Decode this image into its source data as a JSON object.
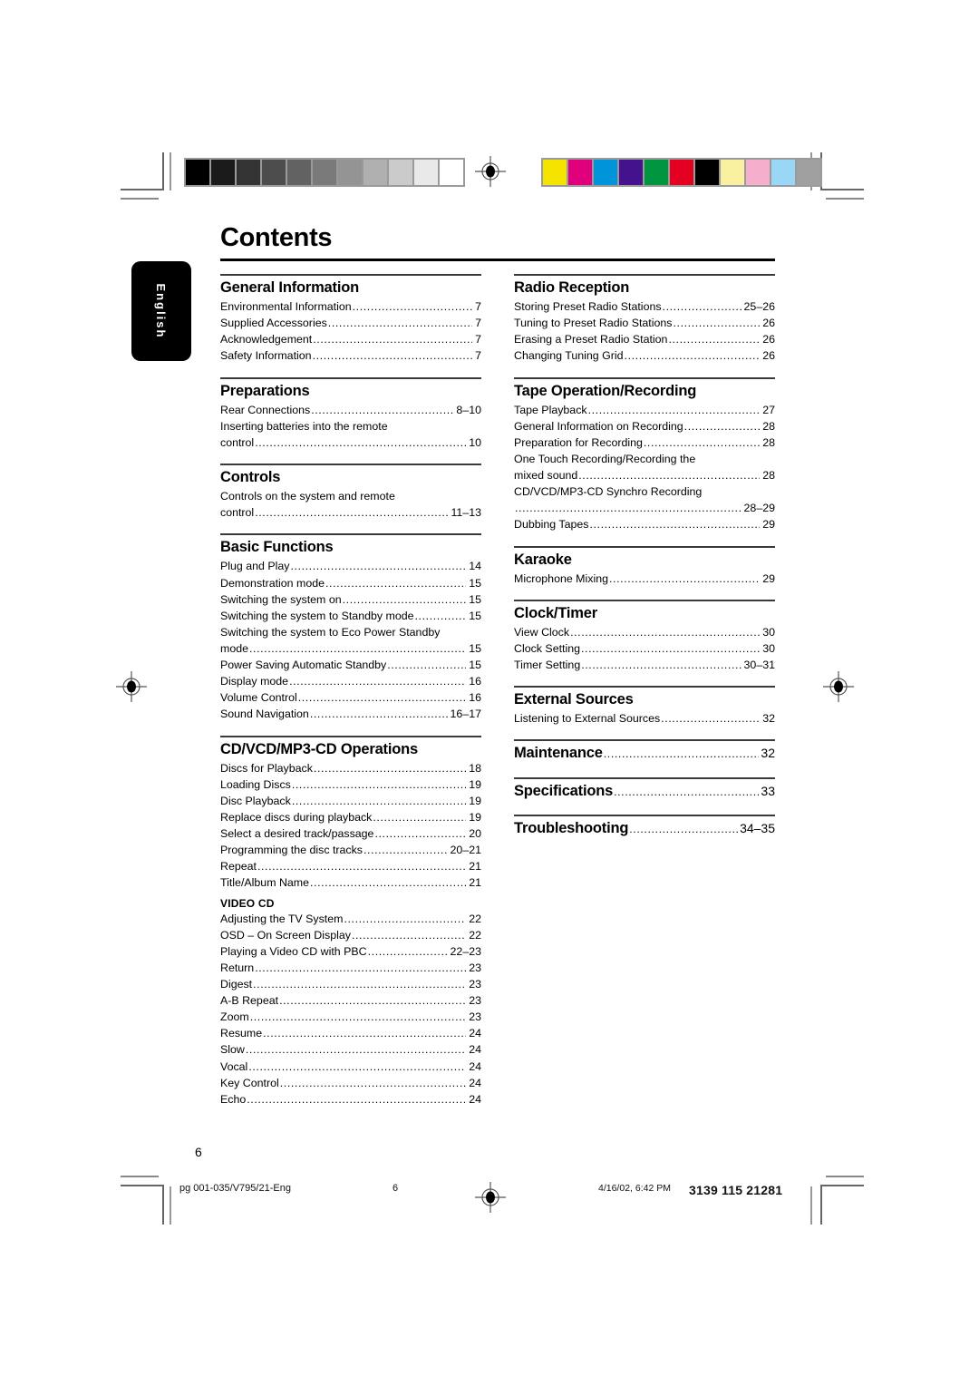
{
  "document": {
    "title": "Contents",
    "language_tab": "English",
    "folio": "6"
  },
  "print_marks": {
    "grayscale_swatches": [
      "#000000",
      "#1b1b1b",
      "#333333",
      "#4d4d4d",
      "#626262",
      "#7a7a7a",
      "#949494",
      "#b0b0b0",
      "#cbcbcb",
      "#e9e9e9",
      "#ffffff"
    ],
    "color_swatches": [
      "#f5e400",
      "#e0007d",
      "#0095db",
      "#44128d",
      "#009640",
      "#e30020",
      "#000000",
      "#f9f0a0",
      "#f5aecb",
      "#9ad6f5",
      "#a0a0a0"
    ],
    "registration_mark": "registration-target-icon"
  },
  "left_column": [
    {
      "heading": "General Information",
      "entries": [
        {
          "label": "Environmental Information",
          "page": "7"
        },
        {
          "label": "Supplied Accessories",
          "page": "7"
        },
        {
          "label": "Acknowledgement",
          "page": "7"
        },
        {
          "label": "Safety Information",
          "page": "7"
        }
      ]
    },
    {
      "heading": "Preparations",
      "entries": [
        {
          "label": "Rear Connections",
          "page": "8–10"
        },
        {
          "label": "Inserting batteries into the remote",
          "page": ""
        },
        {
          "label": "control",
          "page": "10"
        }
      ]
    },
    {
      "heading": "Controls",
      "entries": [
        {
          "label": "Controls on the system and remote",
          "page": ""
        },
        {
          "label": "control",
          "page": "11–13"
        }
      ]
    },
    {
      "heading": "Basic Functions",
      "entries": [
        {
          "label": "Plug and Play",
          "page": "14"
        },
        {
          "label": "Demonstration mode",
          "page": "15"
        },
        {
          "label": "Switching the system on",
          "page": "15"
        },
        {
          "label": "Switching the system to Standby mode",
          "page": "15"
        },
        {
          "label": "Switching the system to Eco Power Standby",
          "page": ""
        },
        {
          "label": "mode",
          "page": "15"
        },
        {
          "label": "Power Saving Automatic Standby",
          "page": "15"
        },
        {
          "label": "Display mode",
          "page": "16"
        },
        {
          "label": "Volume Control",
          "page": "16"
        },
        {
          "label": "Sound Navigation",
          "page": "16–17"
        }
      ]
    },
    {
      "heading": "CD/VCD/MP3-CD Operations",
      "entries": [
        {
          "label": "Discs for Playback",
          "page": "18"
        },
        {
          "label": "Loading Discs",
          "page": "19"
        },
        {
          "label": "Disc Playback",
          "page": "19"
        },
        {
          "label": "Replace discs during playback",
          "page": "19"
        },
        {
          "label": "Select a desired track/passage",
          "page": "20"
        },
        {
          "label": "Programming the disc tracks",
          "page": "20–21"
        },
        {
          "label": "Repeat",
          "page": "21"
        },
        {
          "label": "Title/Album Name",
          "page": "21"
        }
      ],
      "subheading": "VIDEO CD",
      "sub_entries": [
        {
          "label": "Adjusting the TV System",
          "page": "22"
        },
        {
          "label": "OSD – On Screen Display",
          "page": "22"
        },
        {
          "label": "Playing a Video CD with PBC",
          "page": "22–23"
        },
        {
          "label": "Return",
          "page": "23"
        },
        {
          "label": "Digest",
          "page": "23"
        },
        {
          "label": "A-B Repeat",
          "page": "23"
        },
        {
          "label": "Zoom",
          "page": "23"
        },
        {
          "label": "Resume",
          "page": "24"
        },
        {
          "label": "Slow",
          "page": "24"
        },
        {
          "label": "Vocal",
          "page": "24"
        },
        {
          "label": "Key Control",
          "page": "24"
        },
        {
          "label": "Echo",
          "page": "24"
        }
      ]
    }
  ],
  "right_column": [
    {
      "heading": "Radio Reception",
      "entries": [
        {
          "label": "Storing Preset Radio Stations",
          "page": "25–26"
        },
        {
          "label": "Tuning to Preset Radio Stations",
          "page": "26"
        },
        {
          "label": "Erasing a Preset Radio Station",
          "page": "26"
        },
        {
          "label": "Changing Tuning Grid",
          "page": "26"
        }
      ]
    },
    {
      "heading": "Tape Operation/Recording",
      "entries": [
        {
          "label": "Tape Playback",
          "page": "27"
        },
        {
          "label": "General Information on Recording",
          "page": "28"
        },
        {
          "label": "Preparation for Recording",
          "page": "28"
        },
        {
          "label": "One Touch Recording/Recording the",
          "page": ""
        },
        {
          "label": "mixed sound",
          "page": "28"
        },
        {
          "label": "CD/VCD/MP3-CD Synchro Recording",
          "page": ""
        },
        {
          "label": "",
          "page": "28–29"
        },
        {
          "label": "Dubbing Tapes",
          "page": "29"
        }
      ]
    },
    {
      "heading": "Karaoke",
      "entries": [
        {
          "label": "Microphone Mixing",
          "page": "29"
        }
      ]
    },
    {
      "heading": "Clock/Timer",
      "entries": [
        {
          "label": "View Clock",
          "page": "30"
        },
        {
          "label": "Clock Setting",
          "page": "30"
        },
        {
          "label": "Timer Setting",
          "page": "30–31"
        }
      ]
    },
    {
      "heading": "External Sources",
      "entries": [
        {
          "label": "Listening to External Sources",
          "page": "32"
        }
      ]
    },
    {
      "heading": "Maintenance",
      "heading_page": "32",
      "entries": []
    },
    {
      "heading": "Specifications",
      "heading_page": "33",
      "entries": []
    },
    {
      "heading": "Troubleshooting",
      "heading_page": "34–35",
      "entries": []
    }
  ],
  "footer": {
    "job": "pg 001-035/V795/21-Eng",
    "page": "6",
    "timestamp": "4/16/02, 6:42 PM",
    "code": "3139 115 21281"
  }
}
